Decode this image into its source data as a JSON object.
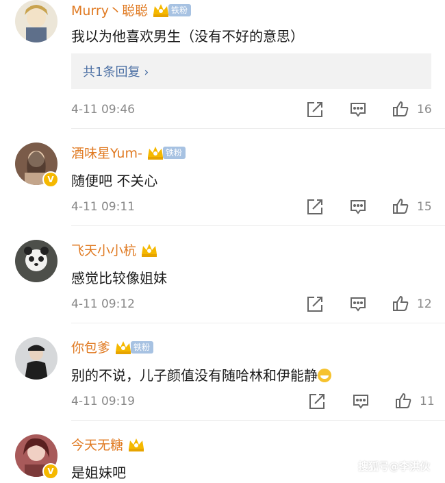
{
  "comments": [
    {
      "username": "Murry丶聪聪",
      "fan_badge": "铁粉",
      "text": "我以为他喜欢男生（没有不好的意思）",
      "replies_label": "共1条回复",
      "time": "4-11 09:46",
      "likes": "16",
      "avatar_color": "#d9c9a8"
    },
    {
      "username": "酒味星Yum-",
      "fan_badge": "铁粉",
      "text": "随便吧 不关心",
      "time": "4-11 09:11",
      "likes": "15",
      "avatar_color": "#8a6a55"
    },
    {
      "username": "飞天小小杭",
      "text": "感觉比较像姐妹",
      "time": "4-11 09:12",
      "likes": "12",
      "avatar_color": "#5b5b5b"
    },
    {
      "username": "你包爹",
      "fan_badge": "铁粉",
      "text": "别的不说，儿子颜值没有随哈林和伊能静",
      "time": "4-11 09:19",
      "likes": "11",
      "avatar_color": "#bfc3c6"
    },
    {
      "username": "今天无糖",
      "text": "是姐妹吧",
      "avatar_color": "#b86a6a"
    }
  ],
  "watermark": "搜狐号@李洪伙",
  "colors": {
    "username": "#e07a22",
    "link": "#4a6ea3",
    "fan_badge_bg": "#a7c2e2",
    "crown": "#f5b800"
  }
}
